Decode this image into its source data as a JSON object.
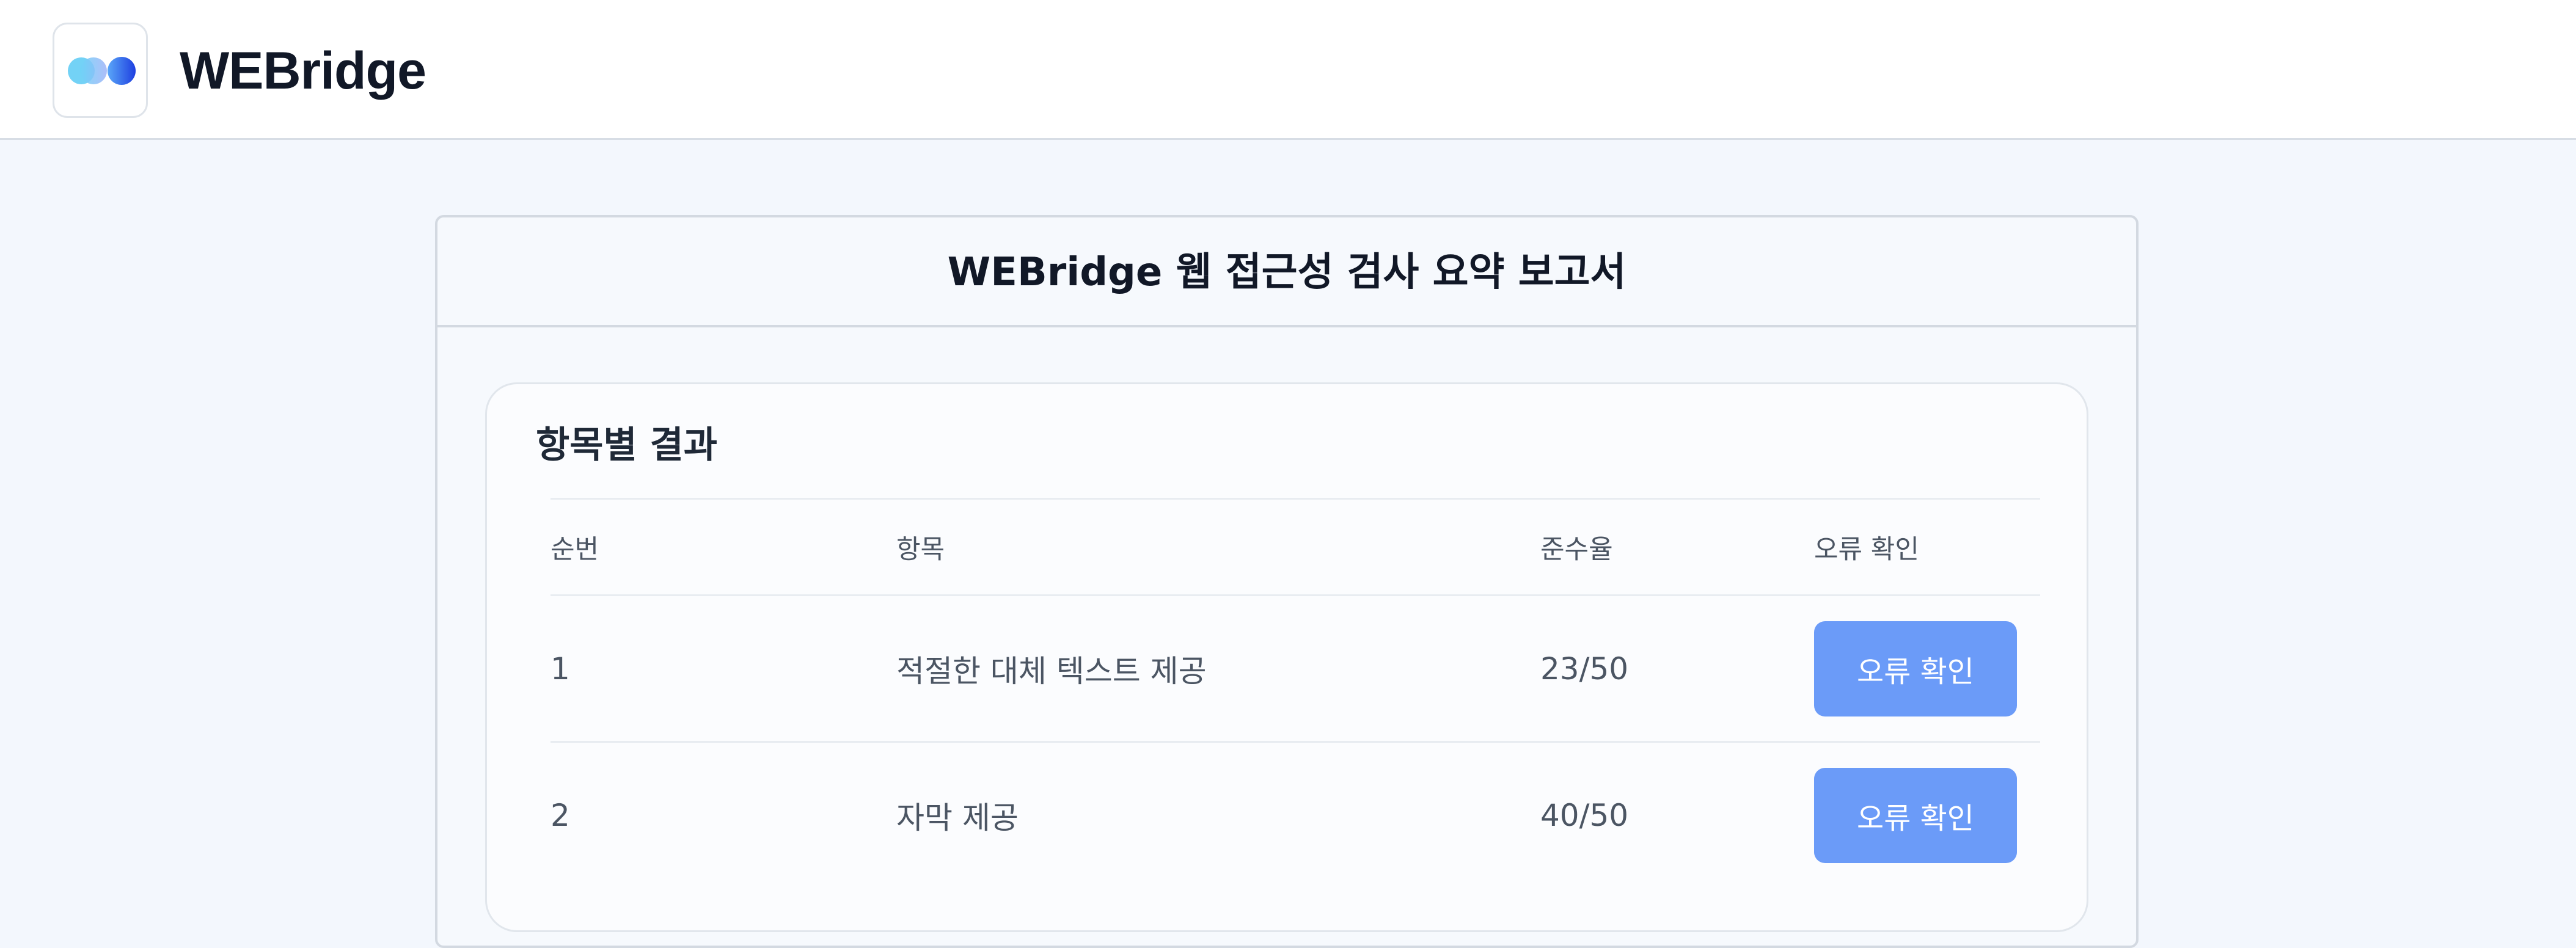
{
  "header": {
    "brand": "WEBridge"
  },
  "report": {
    "title": "WEBridge 웹 접근성 검사 요약 보고서",
    "section_title": "항목별 결과",
    "columns": [
      "순번",
      "항목",
      "준수율",
      "오류 확인"
    ],
    "rows": [
      {
        "no": "1",
        "item": "적절한 대체 텍스트 제공",
        "rate": "23/50",
        "button": "오류 확인"
      },
      {
        "no": "2",
        "item": "자막 제공",
        "rate": "40/50",
        "button": "오류 확인"
      }
    ]
  },
  "colors": {
    "accent_button": "#6b9bf8",
    "page_background": "#f3f7fd"
  },
  "icons": {
    "logo": "two-overlapping-circles-logo-icon"
  }
}
